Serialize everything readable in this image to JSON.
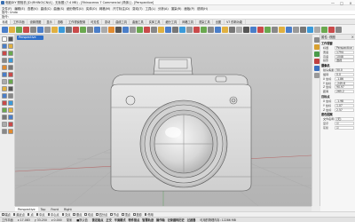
{
  "app": {
    "title": "电脑DIY 照相机 [D:\\RHINO\\CN\\4] - 无标题 (7.4 MB) - [Rhinoceros 7 Commercial (简体)] - [Perspective]"
  },
  "window_controls": [
    "—",
    "□",
    "×"
  ],
  "menu": [
    "文件(F)",
    "编辑(E)",
    "查看(V)",
    "曲线(C)",
    "曲面(S)",
    "细分物件(U)",
    "实体(O)",
    "网格(M)",
    "尺寸标注(D)",
    "变动(T)",
    "工具(L)",
    "分析(A)",
    "渲染(R)",
    "面板(P)",
    "说明(H)"
  ],
  "command_history": "指令: Undo",
  "command_prompt": "指令:",
  "tool_tabs": [
    {
      "label": "标准",
      "active": true
    },
    {
      "label": "工作平面",
      "active": false
    },
    {
      "label": "设置视图",
      "active": false
    },
    {
      "label": "显示",
      "active": false
    },
    {
      "label": "选取",
      "active": false
    },
    {
      "label": "工作视窗配置",
      "active": false
    },
    {
      "label": "可见性",
      "active": false
    },
    {
      "label": "变动",
      "active": false
    },
    {
      "label": "曲线工具",
      "active": false
    },
    {
      "label": "曲面工具",
      "active": false
    },
    {
      "label": "实体工具",
      "active": false
    },
    {
      "label": "细分工具",
      "active": false
    },
    {
      "label": "网格工具",
      "active": false
    },
    {
      "label": "渲染工具",
      "active": false
    },
    {
      "label": "出图",
      "active": false
    },
    {
      "label": "V7 的新功能",
      "active": false
    }
  ],
  "viewport": {
    "label": "Perspective"
  },
  "view_tabs": [
    {
      "label": "Perspective",
      "active": true
    },
    {
      "label": "Top",
      "active": false
    },
    {
      "label": "Front",
      "active": false
    },
    {
      "label": "Right",
      "active": false
    }
  ],
  "osnaps": [
    "端点",
    "最近点",
    "点",
    "中点",
    "中心点",
    "交点",
    "垂点",
    "切点",
    "四分点",
    "节点",
    "顶点",
    "投影",
    "停用"
  ],
  "status": {
    "cplane": "工作平面",
    "x": "x 17.083",
    "y": "y 33.250",
    "z": "z 0.000",
    "units": "毫米",
    "layer": "■默认值",
    "items": [
      "锁定格点",
      "正交",
      "平面模式",
      "物件锁点",
      "智慧轨迹",
      "操作轴",
      "记录建构历史",
      "过滤器"
    ],
    "memory": "可用的物理内存: 12286 MB"
  },
  "properties": {
    "header": "属性: 视图",
    "sections": [
      {
        "title": "工作视窗",
        "rows": [
          {
            "k": "标题",
            "v": "Perspective"
          },
          {
            "k": "宽度",
            "v": "1794"
          },
          {
            "k": "高度",
            "v": "1048"
          },
          {
            "k": "投影",
            "v": "透视"
          }
        ]
      },
      {
        "title": "摄像机",
        "rows": [
          {
            "k": "镜头焦距",
            "v": "50.0"
          },
          {
            "k": "旋转",
            "v": "0.0"
          },
          {
            "k": "X 坐标",
            "v": "-1.86"
          },
          {
            "k": "Y 坐标",
            "v": "-249.6"
          },
          {
            "k": "Z 坐标",
            "v": "90.97"
          },
          {
            "k": "距离",
            "v": "265.2"
          }
        ]
      },
      {
        "title": "目标点",
        "rows": [
          {
            "k": "X 坐标",
            "v": "-1.98"
          },
          {
            "k": "Y 坐标",
            "v": "1.07"
          },
          {
            "k": "Z 坐标",
            "v": "2.57"
          }
        ]
      },
      {
        "title": "底色图案",
        "rows": [
          {
            "k": "文件名称",
            "v": "(无)"
          },
          {
            "k": "显示",
            "v": "☑"
          },
          {
            "k": "灰阶",
            "v": "☑"
          }
        ]
      }
    ]
  }
}
